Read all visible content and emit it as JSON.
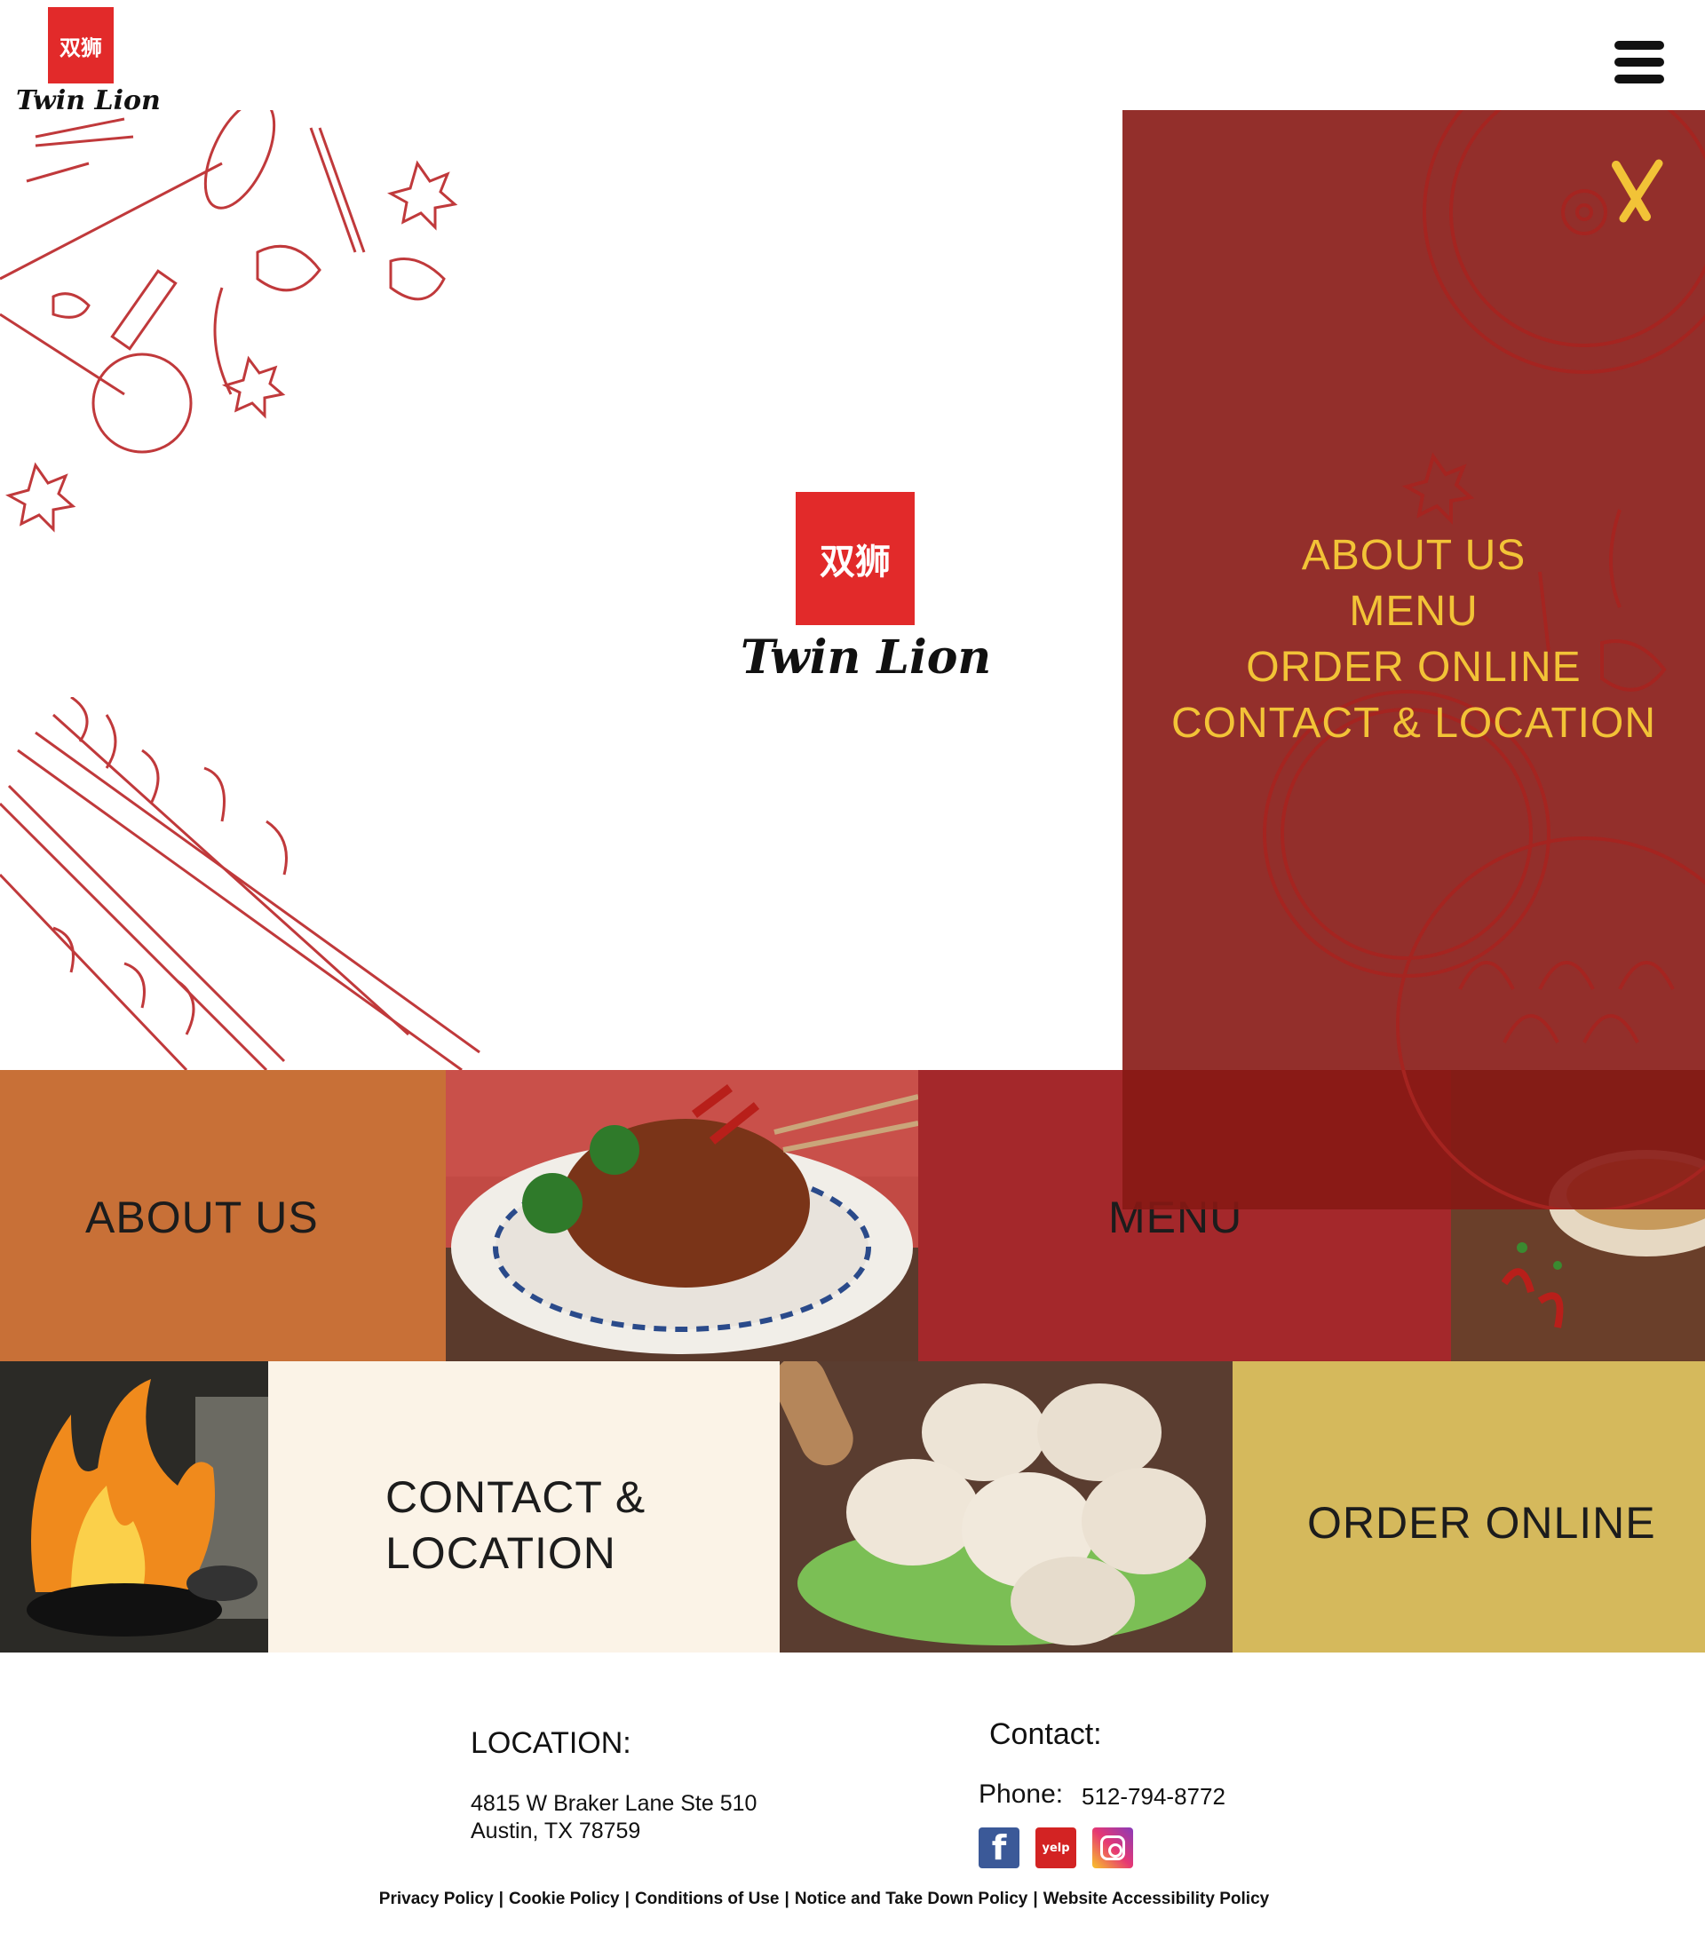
{
  "brand": {
    "name": "Twin Lion",
    "seal_chars": "双狮",
    "seal_color": "#e22a2a"
  },
  "header": {
    "menu_icon": "hamburger-icon"
  },
  "nav_panel": {
    "close_label": "X",
    "items": [
      {
        "label": "ABOUT US"
      },
      {
        "label": "MENU"
      },
      {
        "label": "ORDER ONLINE"
      },
      {
        "label": "CONTACT & LOCATION"
      }
    ],
    "colors": {
      "background": "#871814",
      "text": "#f2c337"
    }
  },
  "tiles": {
    "about": {
      "label": "ABOUT US",
      "color": "#c87037"
    },
    "menu": {
      "label": "MENU",
      "color": "#a4282b"
    },
    "contact": {
      "label_line1": "CONTACT &",
      "label_line2": "LOCATION",
      "color": "#fbf3e7"
    },
    "order": {
      "label": "ORDER ONLINE",
      "color": "#d5b95c"
    }
  },
  "footer": {
    "location_title": "LOCATION:",
    "address_line1": "4815 W Braker Lane Ste 510",
    "address_line2": "Austin, TX 78759",
    "contact_title": "Contact:",
    "phone_label": "Phone:",
    "phone": "512-794-8772",
    "social": [
      {
        "name": "facebook-icon",
        "glyph": "f"
      },
      {
        "name": "yelp-icon",
        "glyph": "yelp"
      },
      {
        "name": "instagram-icon",
        "glyph": ""
      }
    ],
    "legal_links": [
      "Privacy Policy",
      "Cookie Policy",
      "Conditions of Use",
      "Notice and Take Down Policy",
      "Website Accessibility Policy"
    ],
    "legal_separator": "|"
  }
}
